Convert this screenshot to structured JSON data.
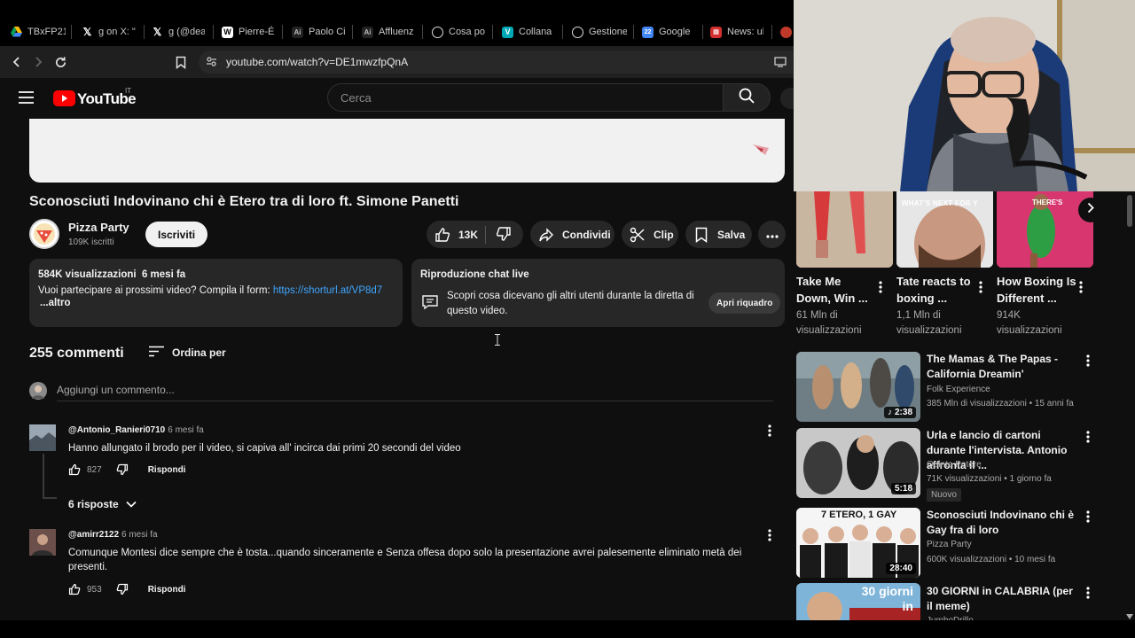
{
  "browser": {
    "tabs": [
      {
        "label": "TBxFP21",
        "fav": "triangle",
        "color": "#4285f4"
      },
      {
        "label": "g on X: \"",
        "fav": "X",
        "color": "#000000"
      },
      {
        "label": "g (@dea",
        "fav": "X",
        "color": "#000000"
      },
      {
        "label": "Pierre-É",
        "fav": "W",
        "color": "#ffffff"
      },
      {
        "label": "Paolo Ci",
        "fav": "AI",
        "color": "#111111"
      },
      {
        "label": "Affluenz",
        "fav": "AI",
        "color": "#111111"
      },
      {
        "label": "Cosa po",
        "fav": "GPT",
        "color": "#ffffff"
      },
      {
        "label": "Collana",
        "fav": "V",
        "color": "#00a8b5"
      },
      {
        "label": "Gestione",
        "fav": "GPT",
        "color": "#ffffff"
      },
      {
        "label": "Google",
        "fav": "cal",
        "color": "#4285f4"
      },
      {
        "label": "News: ul",
        "fav": "news",
        "color": "#d32f2f"
      }
    ],
    "url": "youtube.com/watch?v=DE1mwzfpQnA"
  },
  "header": {
    "logo": "YouTube",
    "country": "IT",
    "search_placeholder": "Cerca"
  },
  "video": {
    "title": "Sconosciuti Indovinano chi è Etero tra di loro ft. Simone Panetti",
    "channel": "Pizza Party",
    "subscribers": "109K iscritti",
    "subscribe_label": "Iscriviti",
    "likes": "13K",
    "share_label": "Condividi",
    "clip_label": "Clip",
    "save_label": "Salva"
  },
  "description": {
    "stats": "584K visualizzazioni  6 mesi fa",
    "text": "Vuoi partecipare ai prossimi video? Compila il form: ",
    "link": "https://shorturl.at/VP8d7",
    "more": "...altro"
  },
  "live_chat": {
    "title": "Riproduzione chat live",
    "text": "Scopri cosa dicevano gli altri utenti durante la diretta di questo video.",
    "button": "Apri riquadro"
  },
  "comments": {
    "count": "255 commenti",
    "sort_label": "Ordina per",
    "add_placeholder": "Aggiungi un commento...",
    "items": [
      {
        "user": "@Antonio_Ranieri0710",
        "time": "6 mesi fa",
        "text": "Hanno allungato il brodo per il video, si capiva all' incirca dai primi 20 secondi del video",
        "likes": "827",
        "reply_label": "Rispondi",
        "replies": "6 risposte"
      },
      {
        "user": "@amirr2122",
        "time": "6 mesi fa",
        "text": "Comunque Montesi dice sempre che è tosta...quando sinceramente e Senza offesa dopo solo la presentazione avrei palesemente eliminato metà dei presenti.",
        "likes": "953",
        "reply_label": "Rispondi"
      }
    ]
  },
  "shorts": [
    {
      "title": "Take Me Down, Win ...",
      "views": "61 Mln di visualizzazioni"
    },
    {
      "title": "Tate reacts to boxing ...",
      "views": "1,1 Mln di visualizzazioni",
      "overlay": "WHAT'S NEXT FOR Y"
    },
    {
      "title": "How Boxing Is Different ...",
      "views": "914K visualizzazioni",
      "overlay": "THERE'S"
    }
  ],
  "recommended": [
    {
      "title": "The Mamas & The Papas - California Dreamin'",
      "channel": "Folk Experience",
      "meta": "385 Mln di visualizzazioni • 15 anni fa",
      "duration": "2:38"
    },
    {
      "title": "Urla e lancio di cartoni durante l'intervista. Antonio affronta il ...",
      "channel": "Quinto Potere",
      "meta": "71K visualizzazioni • 1 giorno fa",
      "duration": "5:18",
      "badge": "Nuovo"
    },
    {
      "title": "Sconosciuti Indovinano chi è Gay fra di loro",
      "channel": "Pizza Party",
      "meta": "600K visualizzazioni • 10 mesi fa",
      "duration": "28:40",
      "overlay": "7 ETERO, 1 GAY"
    },
    {
      "title": "30 GIORNI in CALABRIA (per il meme)",
      "channel": "JumboDrillo",
      "overlay": "30 giorni in"
    }
  ],
  "colors": {
    "background": "#0f0f0f",
    "surface": "#272727",
    "link": "#3ea6ff",
    "youtube_red": "#ff0000"
  }
}
